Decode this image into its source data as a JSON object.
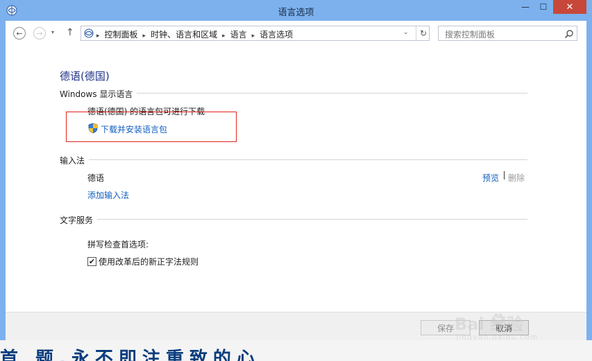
{
  "window": {
    "title": "语言选项",
    "controls": {
      "minimize": "—",
      "maximize": "☐",
      "close": "✕"
    }
  },
  "nav": {
    "back_glyph": "←",
    "forward_glyph": "→",
    "recent_glyph": "▾",
    "up_glyph": "↑",
    "breadcrumbs": [
      "控制面板",
      "时钟、语言和区域",
      "语言",
      "语言选项"
    ],
    "separator": "▸",
    "dropdown_glyph": "⌄",
    "refresh_glyph": "↻",
    "search_placeholder": "搜索控制面板"
  },
  "content": {
    "language_title": "德语(德国)",
    "display_language": {
      "header": "Windows 显示语言",
      "status": "德语(德国) 的语言包可进行下载",
      "download_link": "下载并安装语言包"
    },
    "input_method": {
      "header": "输入法",
      "item": "德语",
      "preview_link": "预览",
      "remove_link": "删除",
      "add_link": "添加输入法"
    },
    "text_services": {
      "header": "文字服务",
      "spell_label": "拼写检查首选项:",
      "checkbox_label": "使用改革后的新正字法规则",
      "checkbox_checked": true,
      "check_glyph": "✔"
    }
  },
  "footer": {
    "save_label": "保存",
    "cancel_label": "取消"
  },
  "bottom_strip_text": "首  题,永不即注重致的心",
  "watermark": {
    "brand": "Bai   经验",
    "sub": "jingyan.baidu.com"
  },
  "colors": {
    "titlebar": "#7cb1ee",
    "close": "#c7483a",
    "link": "#0f5ebd",
    "highlight": "#e0231b"
  }
}
